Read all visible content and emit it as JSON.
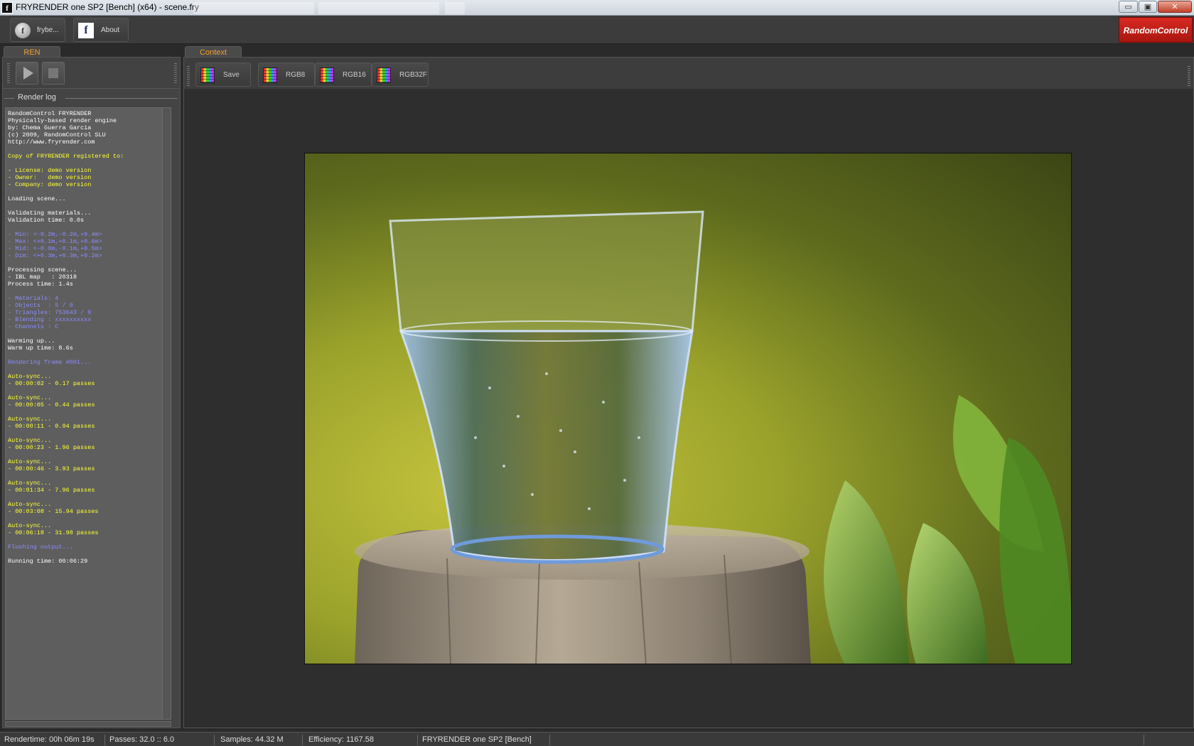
{
  "window": {
    "title": "FRYRENDER one SP2 [Bench] (x64) - scene.fry",
    "app_icon": "f",
    "controls": {
      "minimize": "▭",
      "maximize": "▣",
      "close": "✕"
    }
  },
  "toolbar": {
    "frybe_label": "frybe...",
    "about_label": "About",
    "brand": "RandomControl",
    "frybe_icon": "f",
    "about_icon": "f"
  },
  "tabs": {
    "ren": "REN",
    "context": "Context"
  },
  "ren_panel": {
    "play_icon": "play-icon",
    "stop_icon": "stop-icon",
    "log_title": "Render log"
  },
  "log_lines": [
    {
      "text": "RandomControl FRYRENDER",
      "color": "#ffffff"
    },
    {
      "text": "Physically-based render engine",
      "color": "#ffffff"
    },
    {
      "text": "by: Chema Guerra Garcia",
      "color": "#ffffff"
    },
    {
      "text": "(c) 2009, RandomControl SLU",
      "color": "#ffffff"
    },
    {
      "text": "http://www.fryrender.com",
      "color": "#ffffff"
    },
    {
      "text": "",
      "color": "#ffffff"
    },
    {
      "text": "Copy of FRYRENDER registered to:",
      "color": "#ffff33"
    },
    {
      "text": "",
      "color": "#ffffff"
    },
    {
      "text": "- License: demo version",
      "color": "#ffff33"
    },
    {
      "text": "- Owner:   demo version",
      "color": "#ffff33"
    },
    {
      "text": "- Company: demo version",
      "color": "#ffff33"
    },
    {
      "text": "",
      "color": "#ffffff"
    },
    {
      "text": "Loading scene...",
      "color": "#ffffff"
    },
    {
      "text": "",
      "color": "#ffffff"
    },
    {
      "text": "Validating materials...",
      "color": "#ffffff"
    },
    {
      "text": "Validation time: 0.0s",
      "color": "#ffffff"
    },
    {
      "text": "",
      "color": "#ffffff"
    },
    {
      "text": "- Min: <-0.2m,-0.2m,+0.4m>",
      "color": "#8c8cff"
    },
    {
      "text": "- Max: <+0.1m,+0.1m,+0.6m>",
      "color": "#8c8cff"
    },
    {
      "text": "- Mid: <-0.0m,-0.1m,+0.5m>",
      "color": "#8c8cff"
    },
    {
      "text": "- Dim: <+0.3m,+0.3m,+0.2m>",
      "color": "#8c8cff"
    },
    {
      "text": "",
      "color": "#ffffff"
    },
    {
      "text": "Processing scene...",
      "color": "#ffffff"
    },
    {
      "text": "- IBL map   : 20318",
      "color": "#ffffff"
    },
    {
      "text": "Process time: 1.4s",
      "color": "#ffffff"
    },
    {
      "text": "",
      "color": "#ffffff"
    },
    {
      "text": "- Materials: 4",
      "color": "#8c8cff"
    },
    {
      "text": "- Objects  : 5 / 0",
      "color": "#8c8cff"
    },
    {
      "text": "- Triangles: 753643 / 0",
      "color": "#8c8cff"
    },
    {
      "text": "- Blending : xxxxxxxxxx",
      "color": "#8c8cff"
    },
    {
      "text": "- Channels : C",
      "color": "#8c8cff"
    },
    {
      "text": "",
      "color": "#ffffff"
    },
    {
      "text": "Warming up...",
      "color": "#ffffff"
    },
    {
      "text": "Warm up time: 8.6s",
      "color": "#ffffff"
    },
    {
      "text": "",
      "color": "#ffffff"
    },
    {
      "text": "Rendering frame #001...",
      "color": "#8c8cff"
    },
    {
      "text": "",
      "color": "#ffffff"
    },
    {
      "text": "Auto-sync...",
      "color": "#ffff33"
    },
    {
      "text": "- 00:00:02 - 0.17 passes",
      "color": "#ffff33"
    },
    {
      "text": "",
      "color": "#ffffff"
    },
    {
      "text": "Auto-sync...",
      "color": "#ffff33"
    },
    {
      "text": "- 00:00:05 - 0.44 passes",
      "color": "#ffff33"
    },
    {
      "text": "",
      "color": "#ffffff"
    },
    {
      "text": "Auto-sync...",
      "color": "#ffff33"
    },
    {
      "text": "- 00:00:11 - 0.94 passes",
      "color": "#ffff33"
    },
    {
      "text": "",
      "color": "#ffffff"
    },
    {
      "text": "Auto-sync...",
      "color": "#ffff33"
    },
    {
      "text": "- 00:00:23 - 1.96 passes",
      "color": "#ffff33"
    },
    {
      "text": "",
      "color": "#ffffff"
    },
    {
      "text": "Auto-sync...",
      "color": "#ffff33"
    },
    {
      "text": "- 00:00:46 - 3.93 passes",
      "color": "#ffff33"
    },
    {
      "text": "",
      "color": "#ffffff"
    },
    {
      "text": "Auto-sync...",
      "color": "#ffff33"
    },
    {
      "text": "- 00:01:34 - 7.96 passes",
      "color": "#ffff33"
    },
    {
      "text": "",
      "color": "#ffffff"
    },
    {
      "text": "Auto-sync...",
      "color": "#ffff33"
    },
    {
      "text": "- 00:03:08 - 15.94 passes",
      "color": "#ffff33"
    },
    {
      "text": "",
      "color": "#ffffff"
    },
    {
      "text": "Auto-sync...",
      "color": "#ffff33"
    },
    {
      "text": "- 00:06:18 - 31.98 passes",
      "color": "#ffff33"
    },
    {
      "text": "",
      "color": "#ffffff"
    },
    {
      "text": "Flushing output...",
      "color": "#8c8cff"
    },
    {
      "text": "",
      "color": "#ffffff"
    },
    {
      "text": "Running time: 00:06:29",
      "color": "#ffffff"
    }
  ],
  "context_toolbar": {
    "save_label": "Save",
    "rgb8_label": "RGB8",
    "rgb16_label": "RGB16",
    "rgb32f_label": "RGB32F"
  },
  "statusbar": {
    "rendertime": "Rendertime:  00h 06m 19s",
    "passes": "Passes:  32.0 :: 6.0",
    "samples": "Samples:  44.32 M",
    "efficiency": "Efficiency:  1167.58",
    "product": "FRYRENDER one SP2 [Bench] (x64)"
  },
  "colors": {
    "accent_orange": "#f0a030",
    "brand_red": "#c41f19",
    "log_white": "#ffffff",
    "log_yellow": "#ffff33",
    "log_blue": "#8c8cff"
  }
}
